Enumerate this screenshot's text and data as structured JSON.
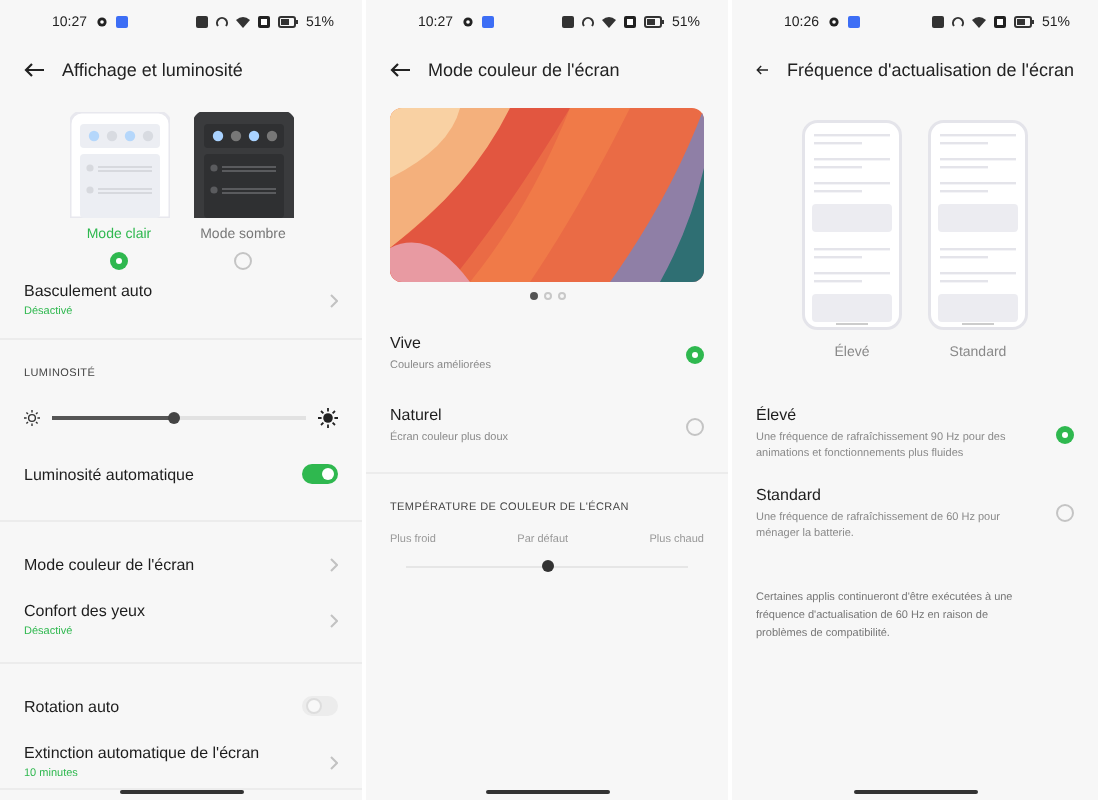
{
  "screens": [
    {
      "kind": "display",
      "status_bar": {
        "time": "10:27",
        "battery": "51%"
      },
      "title": "Affichage et luminosité",
      "theme_options": [
        {
          "label": "Mode clair",
          "kind": "light",
          "selected": true
        },
        {
          "label": "Mode sombre",
          "kind": "dark",
          "selected": false
        }
      ],
      "groups": [
        {
          "items": [
            {
              "kind": "link",
              "title": "Basculement auto",
              "subtitle": "Désactivé"
            }
          ]
        },
        {
          "items": [
            {
              "kind": "section",
              "label": "LUMINOSITÉ"
            },
            {
              "kind": "slider",
              "level": 0.48
            },
            {
              "kind": "toggle",
              "title": "Luminosité automatique",
              "on": true
            }
          ]
        },
        {
          "items": [
            {
              "kind": "link",
              "title": "Mode couleur de l'écran"
            },
            {
              "kind": "link",
              "title": "Confort des yeux",
              "subtitle": "Désactivé"
            }
          ]
        },
        {
          "items": [
            {
              "kind": "toggle",
              "title": "Rotation auto",
              "on": false
            },
            {
              "kind": "link",
              "title": "Extinction automatique de l'écran",
              "subtitle": "10 minutes"
            }
          ]
        }
      ]
    },
    {
      "kind": "color_mode",
      "status_bar": {
        "time": "10:27",
        "battery": "51%"
      },
      "title": "Mode couleur de l'écran",
      "pager": [
        {
          "selected": true
        },
        {
          "selected": false
        },
        {
          "selected": false
        }
      ],
      "options": [
        {
          "title": "Vive",
          "subtitle": "Couleurs améliorées",
          "selected": true
        },
        {
          "title": "Naturel",
          "subtitle": "Écran couleur plus doux",
          "selected": false
        }
      ],
      "section": "TEMPÉRATURE DE COULEUR DE L'ÉCRAN",
      "scale_labels": [
        "Plus froid",
        "Par défaut",
        "Plus chaud"
      ],
      "slider": {
        "level": 0.5
      }
    },
    {
      "kind": "refresh_rate",
      "status_bar": {
        "time": "10:26",
        "battery": "51%"
      },
      "title": "Fréquence d'actualisation de l'écran",
      "previews": [
        {
          "label": "Élevé"
        },
        {
          "label": "Standard"
        }
      ],
      "options": [
        {
          "title": "Élevé",
          "subtitle": "Une fréquence de rafraîchissement 90 Hz pour des animations et fonctionnements plus fluides",
          "selected": true
        },
        {
          "title": "Standard",
          "subtitle": "Une fréquence de rafraîchissement de 60 Hz pour ménager la batterie.",
          "selected": false
        }
      ],
      "note": "Certaines applis continueront d'être exécutées à une fréquence d'actualisation de 60 Hz en raison de problèmes de compatibilité."
    }
  ]
}
